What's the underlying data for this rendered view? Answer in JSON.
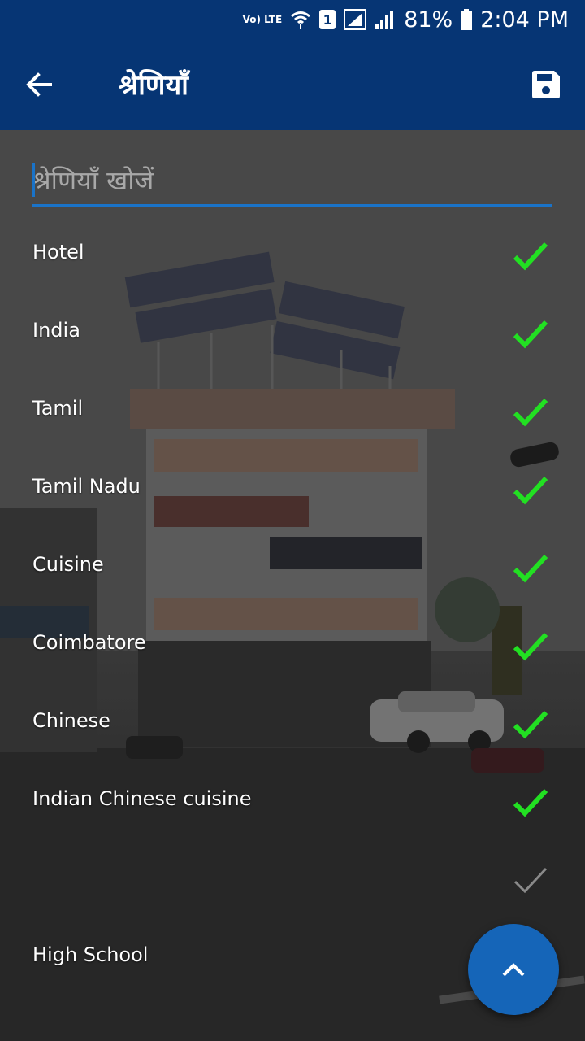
{
  "status_bar": {
    "volte": "Vo) LTE",
    "sim": "1",
    "battery": "81%",
    "time": "2:04 PM"
  },
  "app_bar": {
    "title": "श्रेणियाँ",
    "back_icon": "arrow-left-icon",
    "save_icon": "floppy-disk-icon"
  },
  "search": {
    "placeholder": "श्रेणियाँ खोजें",
    "value": ""
  },
  "categories": [
    {
      "label": "Hotel",
      "checked": true
    },
    {
      "label": "India",
      "checked": true
    },
    {
      "label": "Tamil",
      "checked": true
    },
    {
      "label": "Tamil Nadu",
      "checked": true
    },
    {
      "label": "Cuisine",
      "checked": true
    },
    {
      "label": "Coimbatore",
      "checked": true
    },
    {
      "label": "Chinese",
      "checked": true
    },
    {
      "label": "Indian Chinese cuisine",
      "checked": true
    },
    {
      "label": "",
      "checked": false
    },
    {
      "label": "High School",
      "checked": false
    }
  ],
  "fab": {
    "icon": "chevron-up-icon"
  },
  "colors": {
    "primary": "#063574",
    "accent": "#1a73c8",
    "check": "#22e022",
    "fab": "#1565b8"
  }
}
